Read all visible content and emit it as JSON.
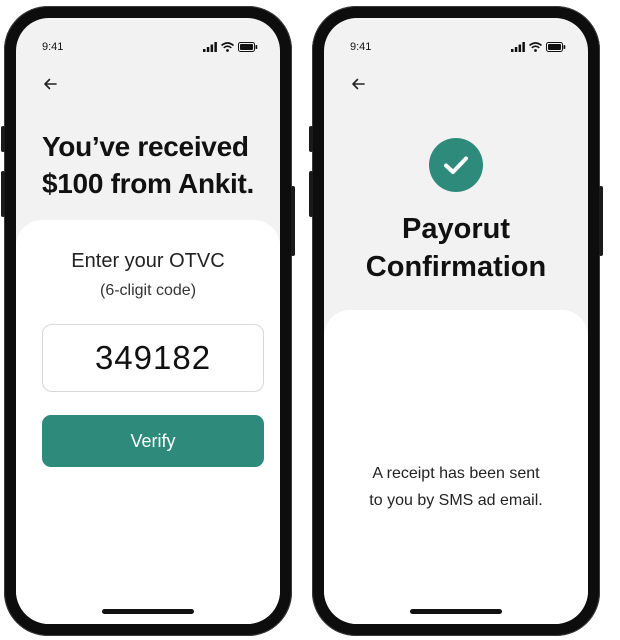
{
  "left_phone": {
    "status": {
      "time": "9:41"
    },
    "headline_line1": "You’ve received",
    "headline_line2": "$100 from Ankit.",
    "card": {
      "title": "Enter your OTVC",
      "subtitle": "(6-cligit code)",
      "code_value": "349182",
      "verify_label": "Verify"
    }
  },
  "right_phone": {
    "status": {
      "time": "9:41"
    },
    "title_line1": "Payorut",
    "title_line2": "Confirmation",
    "receipt_line1": "A receipt has been sent",
    "receipt_line2": "to you by SMS ad email."
  },
  "icons": {
    "back": "back-arrow-icon",
    "signal": "signal-icon",
    "wifi": "wifi-icon",
    "battery": "battery-icon",
    "check": "checkmark-icon"
  },
  "colors": {
    "accent": "#2e8b7c",
    "screen_background": "#f2f2f2",
    "card_background": "#ffffff",
    "frame": "#0d0d0d"
  }
}
